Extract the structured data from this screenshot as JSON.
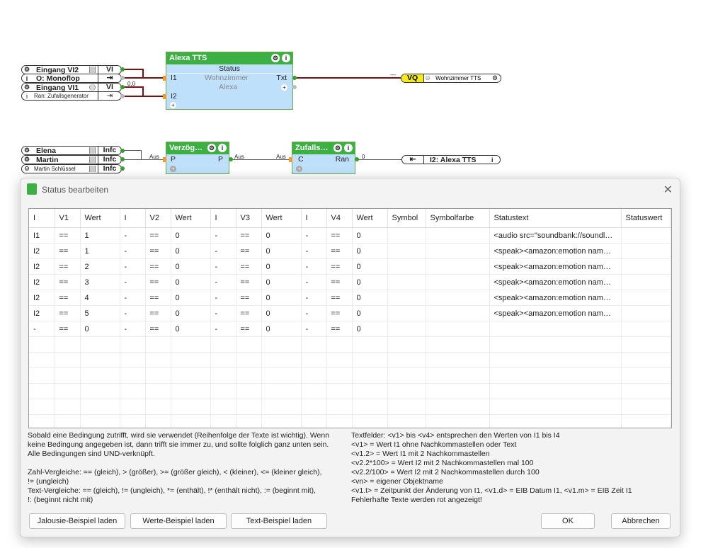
{
  "canvas": {
    "top_inputs": [
      {
        "label": "Eingang VI2",
        "type": "VI"
      },
      {
        "label": "O: Monoflop",
        "type": "⇥"
      },
      {
        "label": "Eingang VI1",
        "type": "VI"
      },
      {
        "label": "Ran: Zufallsgenerator",
        "type": "⇥"
      }
    ],
    "wire_value_top": "0,0",
    "alexa_block": {
      "title": "Alexa TTS",
      "status": "Status",
      "in1": "I1",
      "in1_name": "Wohnzimmer",
      "in1_sub": "Alexa",
      "out": "Txt",
      "in2": "I2"
    },
    "vq_dash": "---",
    "vq_label": "VQ",
    "vq_name": "Wohnzimmer TTS",
    "bottom_inputs": [
      {
        "label": "Elena",
        "type": "Infc"
      },
      {
        "label": "Martin",
        "type": "Infc"
      },
      {
        "label": "Martin Schlüssel",
        "type": "Infc"
      }
    ],
    "delay_block": {
      "title": "Verzög…",
      "in": "P",
      "out": "P",
      "in_label": "Aus",
      "out_label": "Aus"
    },
    "random_block": {
      "title": "Zufalls…",
      "in": "C",
      "out": "Ran",
      "in_label": "Aus",
      "out_value": "0"
    },
    "output_ref": "I2: Alexa TTS"
  },
  "dialog": {
    "title": "Status bearbeiten",
    "columns": [
      "I",
      "V1",
      "Wert",
      "I",
      "V2",
      "Wert",
      "I",
      "V3",
      "Wert",
      "I",
      "V4",
      "Wert",
      "Symbol",
      "Symbolfarbe",
      "Statustext",
      "Statuswert"
    ],
    "rows": [
      [
        "I1",
        "==",
        "1",
        "-",
        "==",
        "0",
        "-",
        "==",
        "0",
        "-",
        "==",
        "0",
        "",
        "",
        "<audio src=\"soundbank://soundl…",
        ""
      ],
      [
        "I2",
        "==",
        "1",
        "-",
        "==",
        "0",
        "-",
        "==",
        "0",
        "-",
        "==",
        "0",
        "",
        "",
        "<speak><amazon:emotion nam…",
        ""
      ],
      [
        "I2",
        "==",
        "2",
        "-",
        "==",
        "0",
        "-",
        "==",
        "0",
        "-",
        "==",
        "0",
        "",
        "",
        "<speak><amazon:emotion nam…",
        ""
      ],
      [
        "I2",
        "==",
        "3",
        "-",
        "==",
        "0",
        "-",
        "==",
        "0",
        "-",
        "==",
        "0",
        "",
        "",
        "<speak><amazon:emotion nam…",
        ""
      ],
      [
        "I2",
        "==",
        "4",
        "-",
        "==",
        "0",
        "-",
        "==",
        "0",
        "-",
        "==",
        "0",
        "",
        "",
        "<speak><amazon:emotion nam…",
        ""
      ],
      [
        "I2",
        "==",
        "5",
        "-",
        "==",
        "0",
        "-",
        "==",
        "0",
        "-",
        "==",
        "0",
        "",
        "",
        "<speak><amazon:emotion nam…",
        ""
      ],
      [
        "-",
        "==",
        "0",
        "-",
        "==",
        "0",
        "-",
        "==",
        "0",
        "-",
        "==",
        "0",
        "",
        "",
        "",
        ""
      ]
    ],
    "help_left": [
      "Sobald eine Bedingung zutrifft, wird sie verwendet (Reihenfolge der Texte ist wichtig). Wenn",
      "keine Bedingung angegeben ist, dann trifft sie immer zu, und sollte folglich ganz unten sein.",
      "Alle Bedingungen sind UND-verknüpft.",
      "",
      "Zahl-Vergleiche: == (gleich), > (größer), >= (größer gleich), < (kleiner), <= (kleiner gleich),",
      "!= (ungleich)",
      "Text-Vergleiche: == (gleich), != (ungleich), *= (enthält), !* (enthält nicht), := (beginnt mit),",
      "!: (beginnt nicht mit)"
    ],
    "help_right": [
      "Textfelder: <v1> bis <v4> entsprechen den Werten von I1 bis I4",
      "<v1> = Wert I1 ohne Nachkommastellen oder Text",
      "<v1.2> = Wert I1 mit 2 Nachkommastellen",
      "<v2.2*100> = Wert I2 mit 2 Nachkommastellen mal 100",
      "<v2.2/100> = Wert I2 mit 2 Nachkommastellen durch 100",
      "<vn> = eigener Objektname",
      "<v1.t> = Zeitpunkt der Änderung von I1, <v1.d> = EIB Datum I1, <v1.m> = EIB Zeit I1",
      "Fehlerhafte Texte werden rot angezeigt!"
    ],
    "buttons": {
      "jalousie": "Jalousie-Beispiel laden",
      "werte": "Werte-Beispiel laden",
      "text": "Text-Beispiel laden",
      "ok": "OK",
      "cancel": "Abbrechen"
    }
  },
  "colors": {
    "block_header": "#3cb043",
    "block_body": "#bfe0fa",
    "wire": "#7a1010",
    "vq_yellow": "#f2ea1a"
  }
}
